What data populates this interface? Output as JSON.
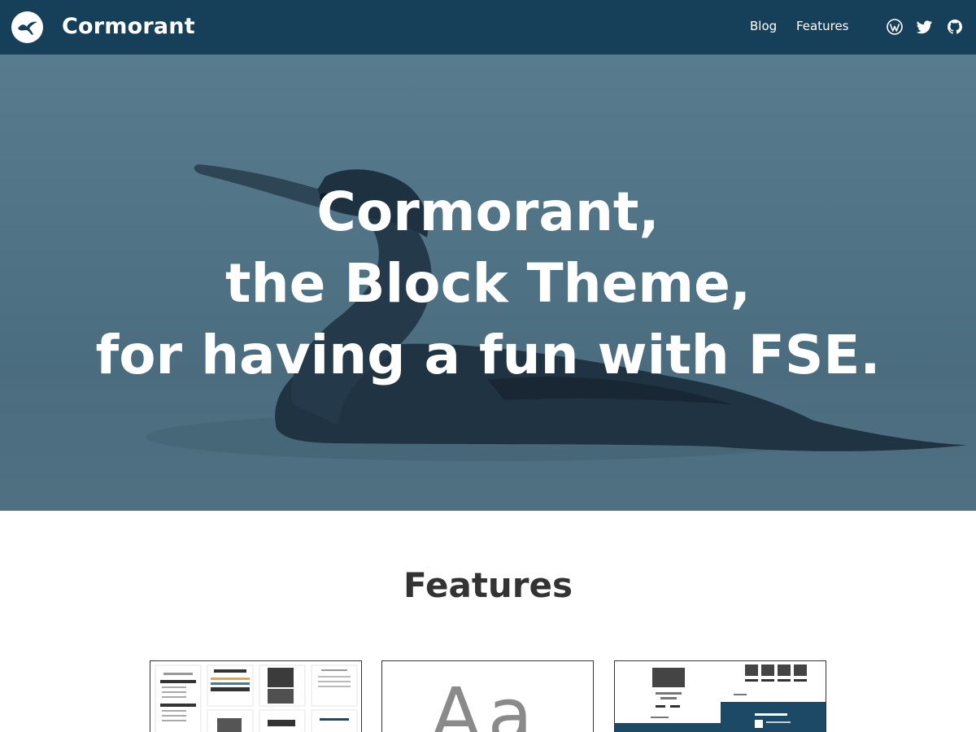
{
  "header": {
    "site_title": "Cormorant",
    "nav": [
      {
        "label": "Blog"
      },
      {
        "label": "Features"
      }
    ],
    "social_icons": [
      "wordpress-icon",
      "twitter-icon",
      "github-icon"
    ],
    "background_color": "#163f5a"
  },
  "hero": {
    "line1": "Cormorant,",
    "line2": "the Block Theme,",
    "line3": "for having a fun with FSE.",
    "overlay_color": "#4f7385"
  },
  "features": {
    "title": "Features",
    "card2_glyph": "Aa"
  }
}
